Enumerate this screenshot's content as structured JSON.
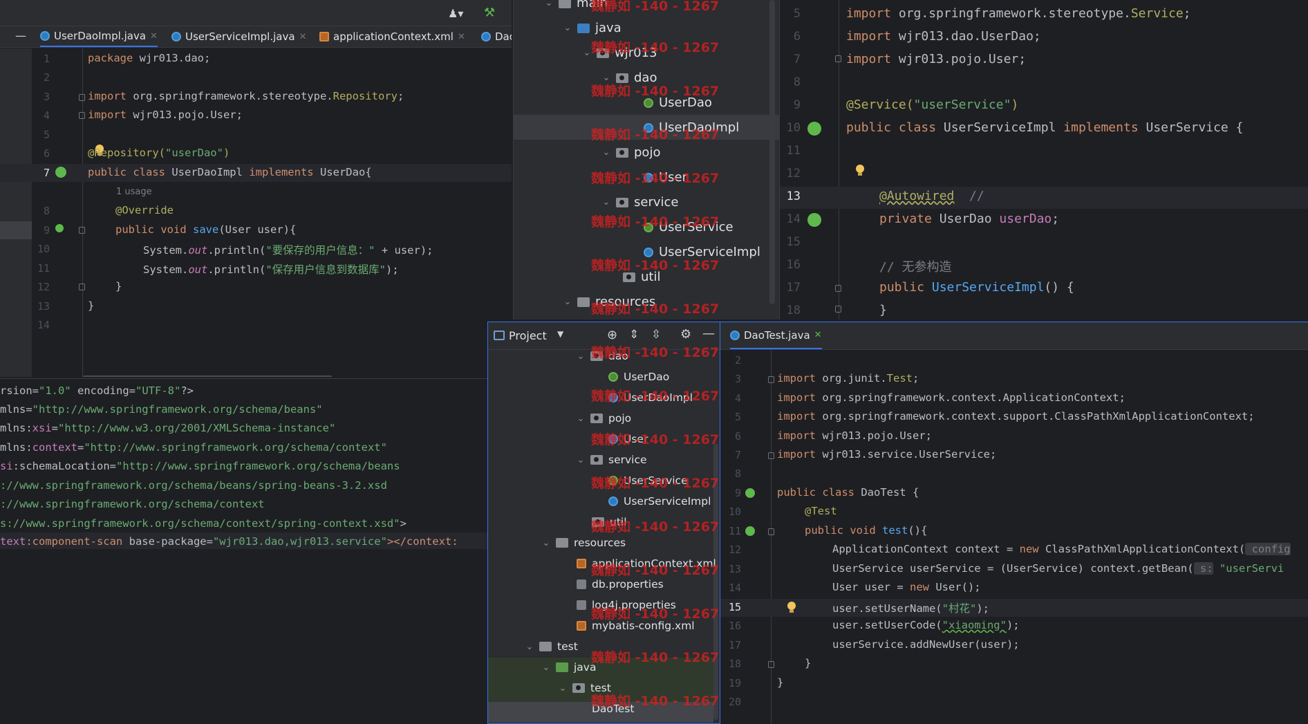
{
  "left_editor": {
    "tabs": [
      {
        "label": "UserDaoImpl.java",
        "icon": "class-icon"
      },
      {
        "label": "UserServiceImpl.java",
        "icon": "class-icon"
      },
      {
        "label": "applicationContext.xml",
        "icon": "xml-icon"
      },
      {
        "label": "Dao",
        "icon": "class-icon"
      }
    ],
    "line_numbers": [
      "1",
      "2",
      "3",
      "4",
      "5",
      "6",
      "7",
      "8",
      "9",
      "10",
      "11",
      "12",
      "13",
      "14"
    ],
    "code": {
      "l1a": "package",
      "l1b": " wjr013.dao;",
      "l3a": "import",
      "l3b": " org.springframework.stereotype.",
      "l3c": "Repository",
      "l3d": ";",
      "l4a": "import",
      "l4b": " wjr013.pojo.User;",
      "l6a": "@Repository(",
      "l6b": "\"userDao\"",
      "l6c": ")",
      "l7a": "public class",
      "l7b": " UserDaoImpl ",
      "l7c": "implements",
      "l7d": " UserDao{",
      "usage": "1 usage",
      "l8": "@Override",
      "l9a": "public void",
      "l9b": " save",
      "l9c": "(User user){",
      "l10a": "System.",
      "l10b": "out",
      "l10c": ".println(",
      "l10d": "\"要保存的用户信息：\"",
      "l10e": " + user);",
      "l11a": "System.",
      "l11b": "out",
      "l11c": ".println(",
      "l11d": "\"保存用户信息到数据库\"",
      "l11e": ");",
      "l12": "}",
      "l13": "}"
    }
  },
  "xml_editor": {
    "lines": [
      {
        "a": "rsion=",
        "b": "\"1.0\"",
        "c": " encoding=",
        "d": "\"UTF-8\"",
        "e": "?>"
      },
      {
        "a": "mlns=",
        "b": "\"http://www.springframework.org/schema/beans\"",
        "c": "",
        "d": "",
        "e": ""
      },
      {
        "a": "mlns:",
        "b": "xsi",
        "c": "=",
        "d": "\"http://www.w3.org/2001/XMLSchema-instance\"",
        "e": ""
      },
      {
        "a": "mlns:",
        "b": "context",
        "c": "=",
        "d": "\"http://www.springframework.org/schema/context\"",
        "e": ""
      },
      {
        "a": "si",
        "b": ":schemaLocation=",
        "c": "",
        "d": "\"http://www.springframework.org/schema/beans",
        "e": ""
      },
      {
        "a": "",
        "b": "",
        "c": "",
        "d": "://www.springframework.org/schema/beans/spring-beans-3.2.xsd",
        "e": ""
      },
      {
        "a": "",
        "b": "",
        "c": "",
        "d": "://www.springframework.org/schema/context",
        "e": ""
      },
      {
        "a": "",
        "b": "",
        "c": "",
        "d": "s://www.springframework.org/schema/context/spring-context.xsd\"",
        "e": ">"
      },
      {
        "a": "text",
        "b": ":component-scan",
        "c": " base-package=",
        "d": "\"wjr013.dao,wjr013.service\"",
        "e": "></context:"
      }
    ]
  },
  "top_tree": {
    "items": [
      {
        "label": "main"
      },
      {
        "label": "java"
      },
      {
        "label": "wjr013"
      },
      {
        "label": "dao"
      },
      {
        "label": "UserDao"
      },
      {
        "label": "UserDaoImpl"
      },
      {
        "label": "pojo"
      },
      {
        "label": "User"
      },
      {
        "label": "service"
      },
      {
        "label": "UserService"
      },
      {
        "label": "UserServiceImpl"
      },
      {
        "label": "util"
      },
      {
        "label": "resources"
      }
    ]
  },
  "service_editor": {
    "line_numbers": [
      "5",
      "6",
      "7",
      "8",
      "9",
      "10",
      "11",
      "12",
      "13",
      "14",
      "15",
      "16",
      "17",
      "18"
    ],
    "code": {
      "l5a": "import",
      "l5b": " org.springframework.stereotype.",
      "l5c": "Service",
      "l5d": ";",
      "l6a": "import",
      "l6b": " wjr013.dao.UserDao;",
      "l7a": "import",
      "l7b": " wjr013.pojo.User;",
      "l9a": "@Service(",
      "l9b": "\"userService\"",
      "l9c": ")",
      "l10a": "public class",
      "l10b": " UserServiceImpl ",
      "l10c": "implements",
      "l10d": " UserService {",
      "l13a": "@Autowired",
      "l13b": "  //",
      "l14a": "private",
      "l14b": " UserDao ",
      "l14c": "userDao",
      "l14d": ";",
      "l16": "// 无参构造",
      "l17a": "public",
      "l17b": " UserServiceImpl",
      "l17c": "() {",
      "l18": "}"
    }
  },
  "project_panel": {
    "title": "Project",
    "items": [
      {
        "label": "dao"
      },
      {
        "label": "UserDao"
      },
      {
        "label": "UserDaoImpl"
      },
      {
        "label": "pojo"
      },
      {
        "label": "User"
      },
      {
        "label": "service"
      },
      {
        "label": "UserService"
      },
      {
        "label": "UserServiceImpl"
      },
      {
        "label": "util"
      },
      {
        "label": "resources"
      },
      {
        "label": "applicationContext.xml"
      },
      {
        "label": "db.properties"
      },
      {
        "label": "log4j.properties"
      },
      {
        "label": "mybatis-config.xml"
      },
      {
        "label": "test"
      },
      {
        "label": "java"
      },
      {
        "label": "test"
      },
      {
        "label": "DaoTest"
      }
    ]
  },
  "test_editor": {
    "tab": "DaoTest.java",
    "line_numbers": [
      "2",
      "3",
      "4",
      "5",
      "6",
      "7",
      "8",
      "9",
      "10",
      "11",
      "12",
      "13",
      "14",
      "15",
      "16",
      "17",
      "18",
      "19",
      "20"
    ],
    "code": {
      "l3a": "import",
      "l3b": " org.junit.",
      "l3c": "Test",
      "l3d": ";",
      "l4a": "import",
      "l4b": " org.springframework.context.ApplicationContext;",
      "l5a": "import",
      "l5b": " org.springframework.context.support.ClassPathXmlApplicationContext;",
      "l6a": "import",
      "l6b": " wjr013.pojo.User;",
      "l7a": "import",
      "l7b": " wjr013.service.UserService;",
      "l9a": "public class",
      "l9b": " DaoTest {",
      "l10": "@Test",
      "l11a": "public void",
      "l11b": " test",
      "l11c": "(){",
      "l12a": "ApplicationContext context = ",
      "l12b": "new",
      "l12c": " ClassPathXmlApplicationContext(",
      "l12d": " config",
      "l13a": "UserService userService = (UserService) context.getBean(",
      "l13b": " s:",
      "l13c": " \"userServi",
      "l14a": "User user = ",
      "l14b": "new",
      "l14c": " User();",
      "l15a": "user.setUserName(",
      "l15b": "\"村花\"",
      "l15c": ");",
      "l16a": "user.setUserCode(",
      "l16b": "\"xiaoming\"",
      "l16c": ");",
      "l17": "userService.addNewUser(user);",
      "l18": "}",
      "l19": "}"
    }
  },
  "watermark": "魏静如 -140 - 1267",
  "colors": {
    "bg": "#1e1f22",
    "keyword": "#cf8e6d",
    "string": "#6aab73",
    "annotation": "#b3ae60",
    "method": "#56a8f5",
    "field": "#c77dbb"
  }
}
